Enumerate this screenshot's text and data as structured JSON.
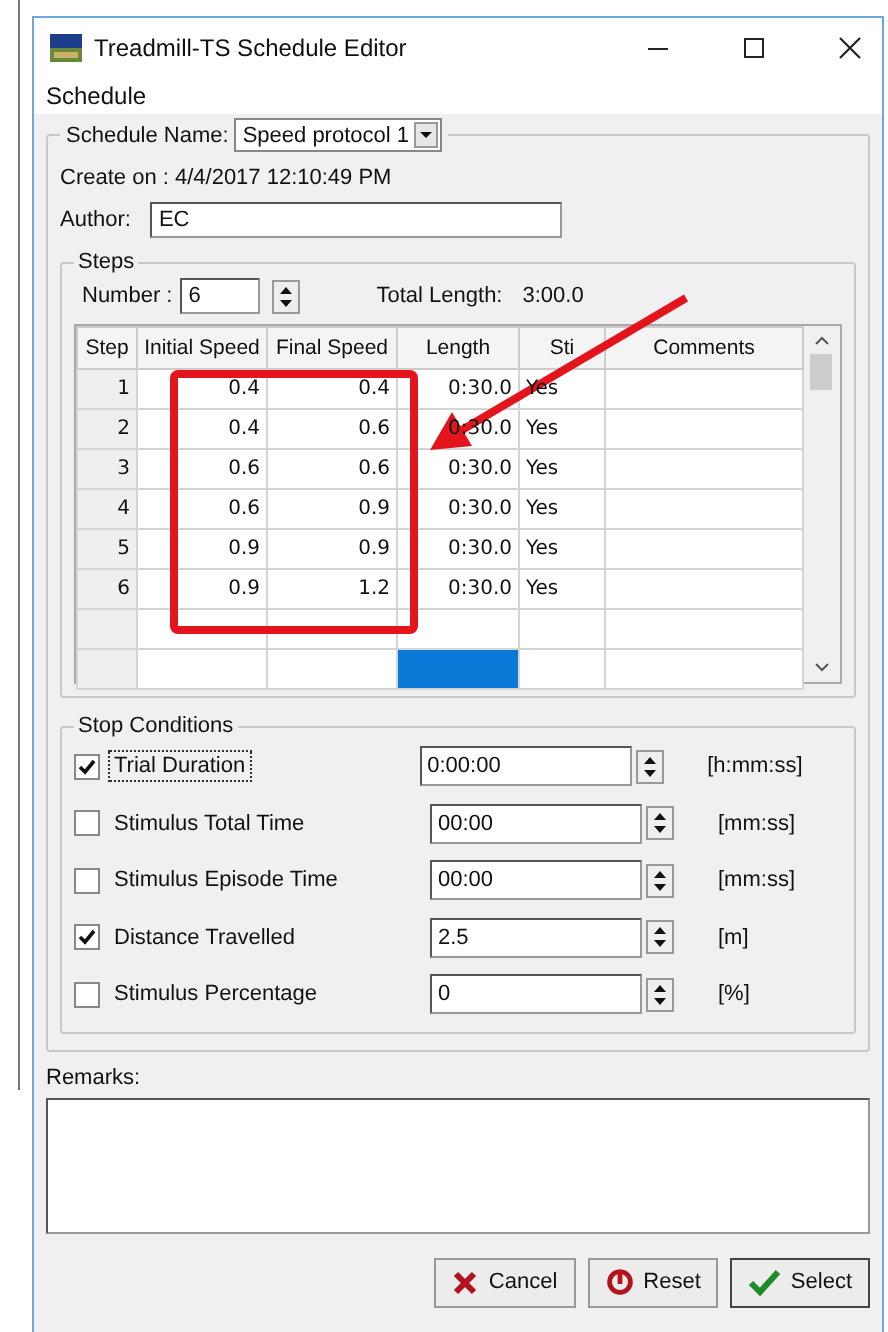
{
  "window": {
    "title": "Treadmill-TS Schedule Editor"
  },
  "menu": [
    "Schedule"
  ],
  "schedule_name": {
    "label": "Schedule Name:",
    "value": "Speed protocol 1"
  },
  "created": "Create on : 4/4/2017 12:10:49 PM",
  "author": {
    "label": "Author:",
    "value": "EC"
  },
  "steps": {
    "title": "Steps",
    "number_label": "Number :",
    "number": "6",
    "total_label": "Total Length:",
    "total": "3:00.0",
    "table": {
      "columns": [
        "Step",
        "Initial Speed",
        "Final Speed",
        "Length",
        "Sti",
        "Comments"
      ],
      "rows": [
        {
          "step": "1",
          "initial_speed": "0.4",
          "final_speed": "0.4",
          "length": "0:30.0",
          "stim": "Yes"
        },
        {
          "step": "2",
          "initial_speed": "0.4",
          "final_speed": "0.6",
          "length": "0:30.0",
          "stim": "Yes"
        },
        {
          "step": "3",
          "initial_speed": "0.6",
          "final_speed": "0.6",
          "length": "0:30.0",
          "stim": "Yes"
        },
        {
          "step": "4",
          "initial_speed": "0.6",
          "final_speed": "0.9",
          "length": "0:30.0",
          "stim": "Yes"
        },
        {
          "step": "5",
          "initial_speed": "0.9",
          "final_speed": "0.9",
          "length": "0:30.0",
          "stim": "Yes"
        },
        {
          "step": "6",
          "initial_speed": "0.9",
          "final_speed": "1.2",
          "length": "0:30.0",
          "stim": "Yes"
        }
      ],
      "blank_rows": [
        {
          "selected": false
        },
        {
          "selected": true
        }
      ]
    }
  },
  "stop_conditions": {
    "title": "Stop Conditions",
    "items": [
      {
        "label": "Trial Duration",
        "checked": true,
        "focused": true,
        "value": "0:00:00",
        "unit": "[h:mm:ss]"
      },
      {
        "label": "Stimulus Total Time",
        "checked": false,
        "focused": false,
        "value": "00:00",
        "unit": "[mm:ss]"
      },
      {
        "label": "Stimulus Episode Time",
        "checked": false,
        "focused": false,
        "value": "00:00",
        "unit": "[mm:ss]"
      },
      {
        "label": "Distance Travelled",
        "checked": true,
        "focused": false,
        "value": "2.5",
        "unit": "[m]"
      },
      {
        "label": "Stimulus Percentage",
        "checked": false,
        "focused": false,
        "value": "0",
        "unit": "[%]"
      }
    ]
  },
  "remarks": {
    "label": "Remarks:"
  },
  "buttons": [
    {
      "label": "Cancel",
      "kind": "cancel"
    },
    {
      "label": "Reset",
      "kind": "reset"
    },
    {
      "label": "Select",
      "kind": "select"
    }
  ]
}
